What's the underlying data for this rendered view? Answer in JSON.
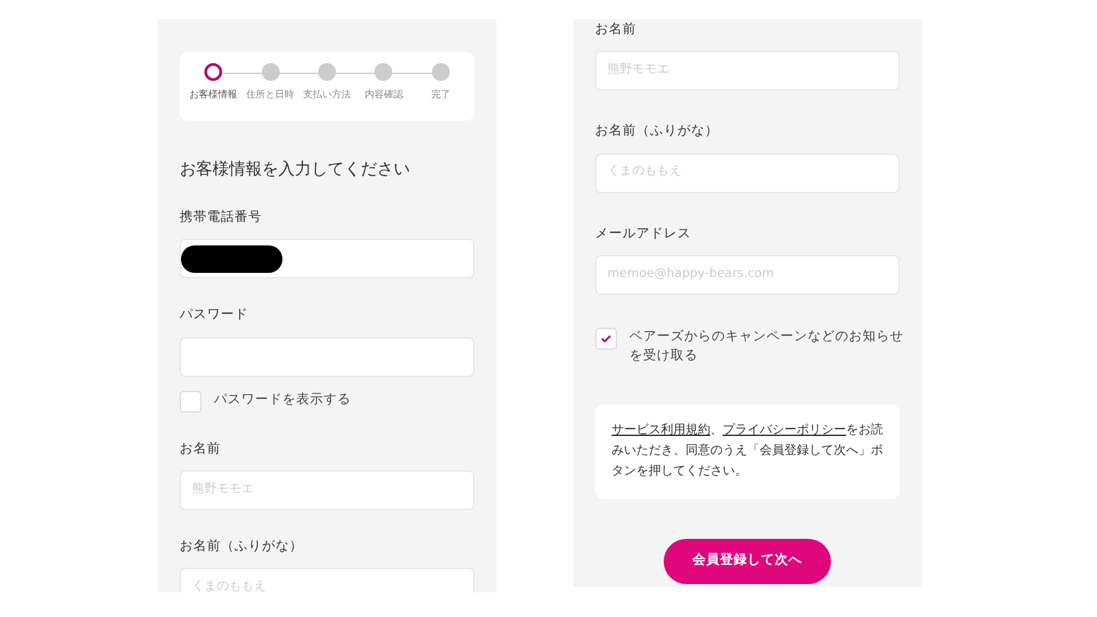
{
  "left_screen": {
    "steps": [
      {
        "label": "お客様情報",
        "selected": true
      },
      {
        "label": "住所と日時",
        "selected": false
      },
      {
        "label": "支払い方法",
        "selected": false
      },
      {
        "label": "内容確認",
        "selected": false
      },
      {
        "label": "完了",
        "selected": false
      }
    ],
    "heading": "お客様情報を入力してください",
    "fields": [
      {
        "kind": "phone",
        "label": "携帯電話番号",
        "redacted": true
      },
      {
        "kind": "password",
        "label": "パスワード"
      },
      {
        "kind": "text",
        "label": "お名前",
        "placeholder": "熊野モモエ"
      },
      {
        "kind": "text",
        "label": "お名前（ふりがな）",
        "placeholder": "くまのももえ"
      }
    ],
    "show_password": {
      "label": "パスワードを表示する",
      "checked": false
    }
  },
  "right_screen": {
    "fields": [
      {
        "label": "お名前",
        "placeholder": "熊野モモエ"
      },
      {
        "label": "お名前（ふりがな）",
        "placeholder": "くまのももえ"
      },
      {
        "label": "メールアドレス",
        "placeholder": "memoe@happy-bears.com"
      }
    ],
    "newsletter": {
      "label": "ベアーズからのキャンペーンなどのお知らせを受け取る",
      "checked": true
    },
    "consent": [
      {
        "kind": "link",
        "text": "サービス利用規約"
      },
      {
        "kind": "text",
        "text": "、"
      },
      {
        "kind": "link",
        "text": "プライバシーポリシー"
      },
      {
        "kind": "text",
        "text": "をお読みいただき、同意のうえ「会員登録して次へ」ボタンを押してください。"
      }
    ],
    "submit_button": "会員登録して次へ"
  }
}
